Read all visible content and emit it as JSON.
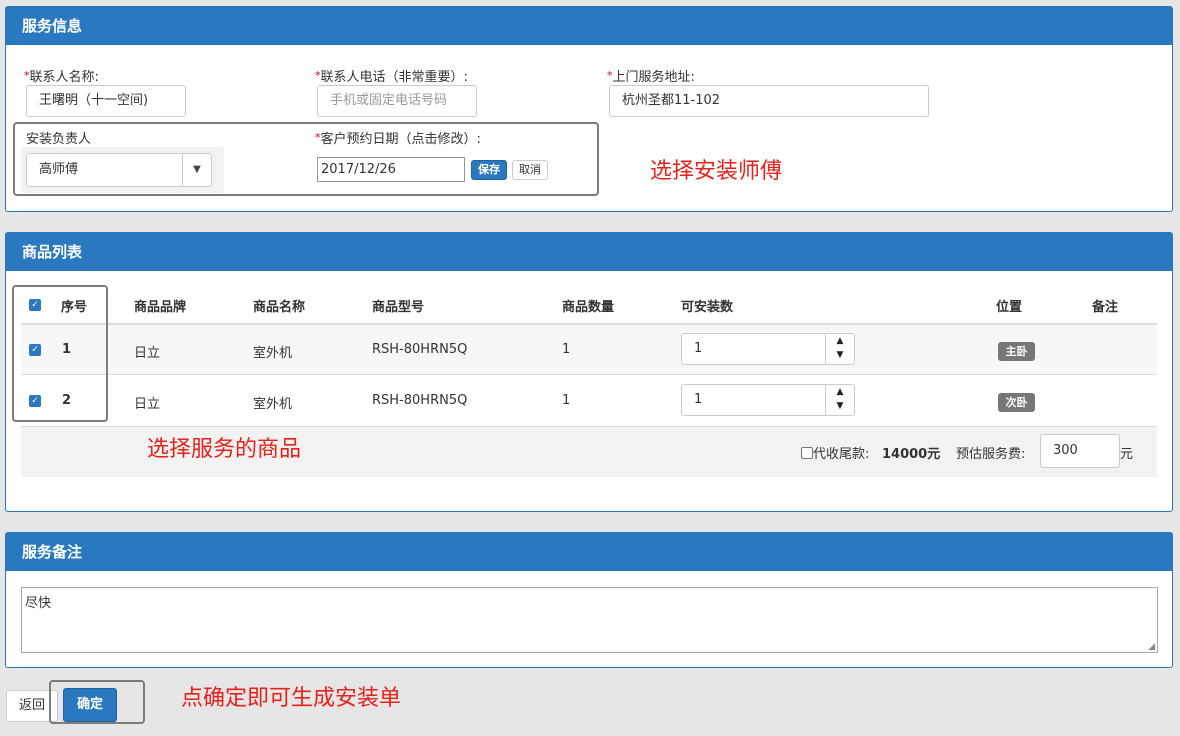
{
  "service_info": {
    "title": "服务信息",
    "required_mark": "*",
    "contact_name_label": "联系人名称:",
    "contact_name_value": "王曙明（十一空间)",
    "contact_phone_label": "联系人电话（非常重要）:",
    "contact_phone_placeholder": "手机或固定电话号码",
    "address_label": "上门服务地址:",
    "address_value": "杭州圣都11-102",
    "installer_label": "安装负责人",
    "installer_value": "高师傅",
    "date_label": "客户预约日期（点击修改）:",
    "date_value": "2017/12/26",
    "save_label": "保存",
    "cancel_label": "取消",
    "annotation": "选择安装师傅"
  },
  "products": {
    "title": "商品列表",
    "columns": [
      "序号",
      "商品品牌",
      "商品名称",
      "商品型号",
      "商品数量",
      "可安装数",
      "位置",
      "备注"
    ],
    "rows": [
      {
        "index": "1",
        "brand": "日立",
        "name": "室外机",
        "model": "RSH-80HRN5Q",
        "quantity": "1",
        "installable": "1",
        "location": "主卧",
        "note": ""
      },
      {
        "index": "2",
        "brand": "日立",
        "name": "室外机",
        "model": "RSH-80HRN5Q",
        "quantity": "1",
        "installable": "1",
        "location": "次卧",
        "note": ""
      }
    ],
    "cod_label": "代收尾款:",
    "cod_amount": "14000元",
    "fee_label": "预估服务费:",
    "fee_value": "300",
    "fee_unit": "元",
    "annotation": "选择服务的商品"
  },
  "remarks": {
    "title": "服务备注",
    "value": "尽快"
  },
  "actions": {
    "back_label": "返回",
    "confirm_label": "确定",
    "annotation": "点确定即可生成安装单"
  },
  "colors": {
    "accent": "#2a79c0",
    "annotation": "#e8211a"
  }
}
